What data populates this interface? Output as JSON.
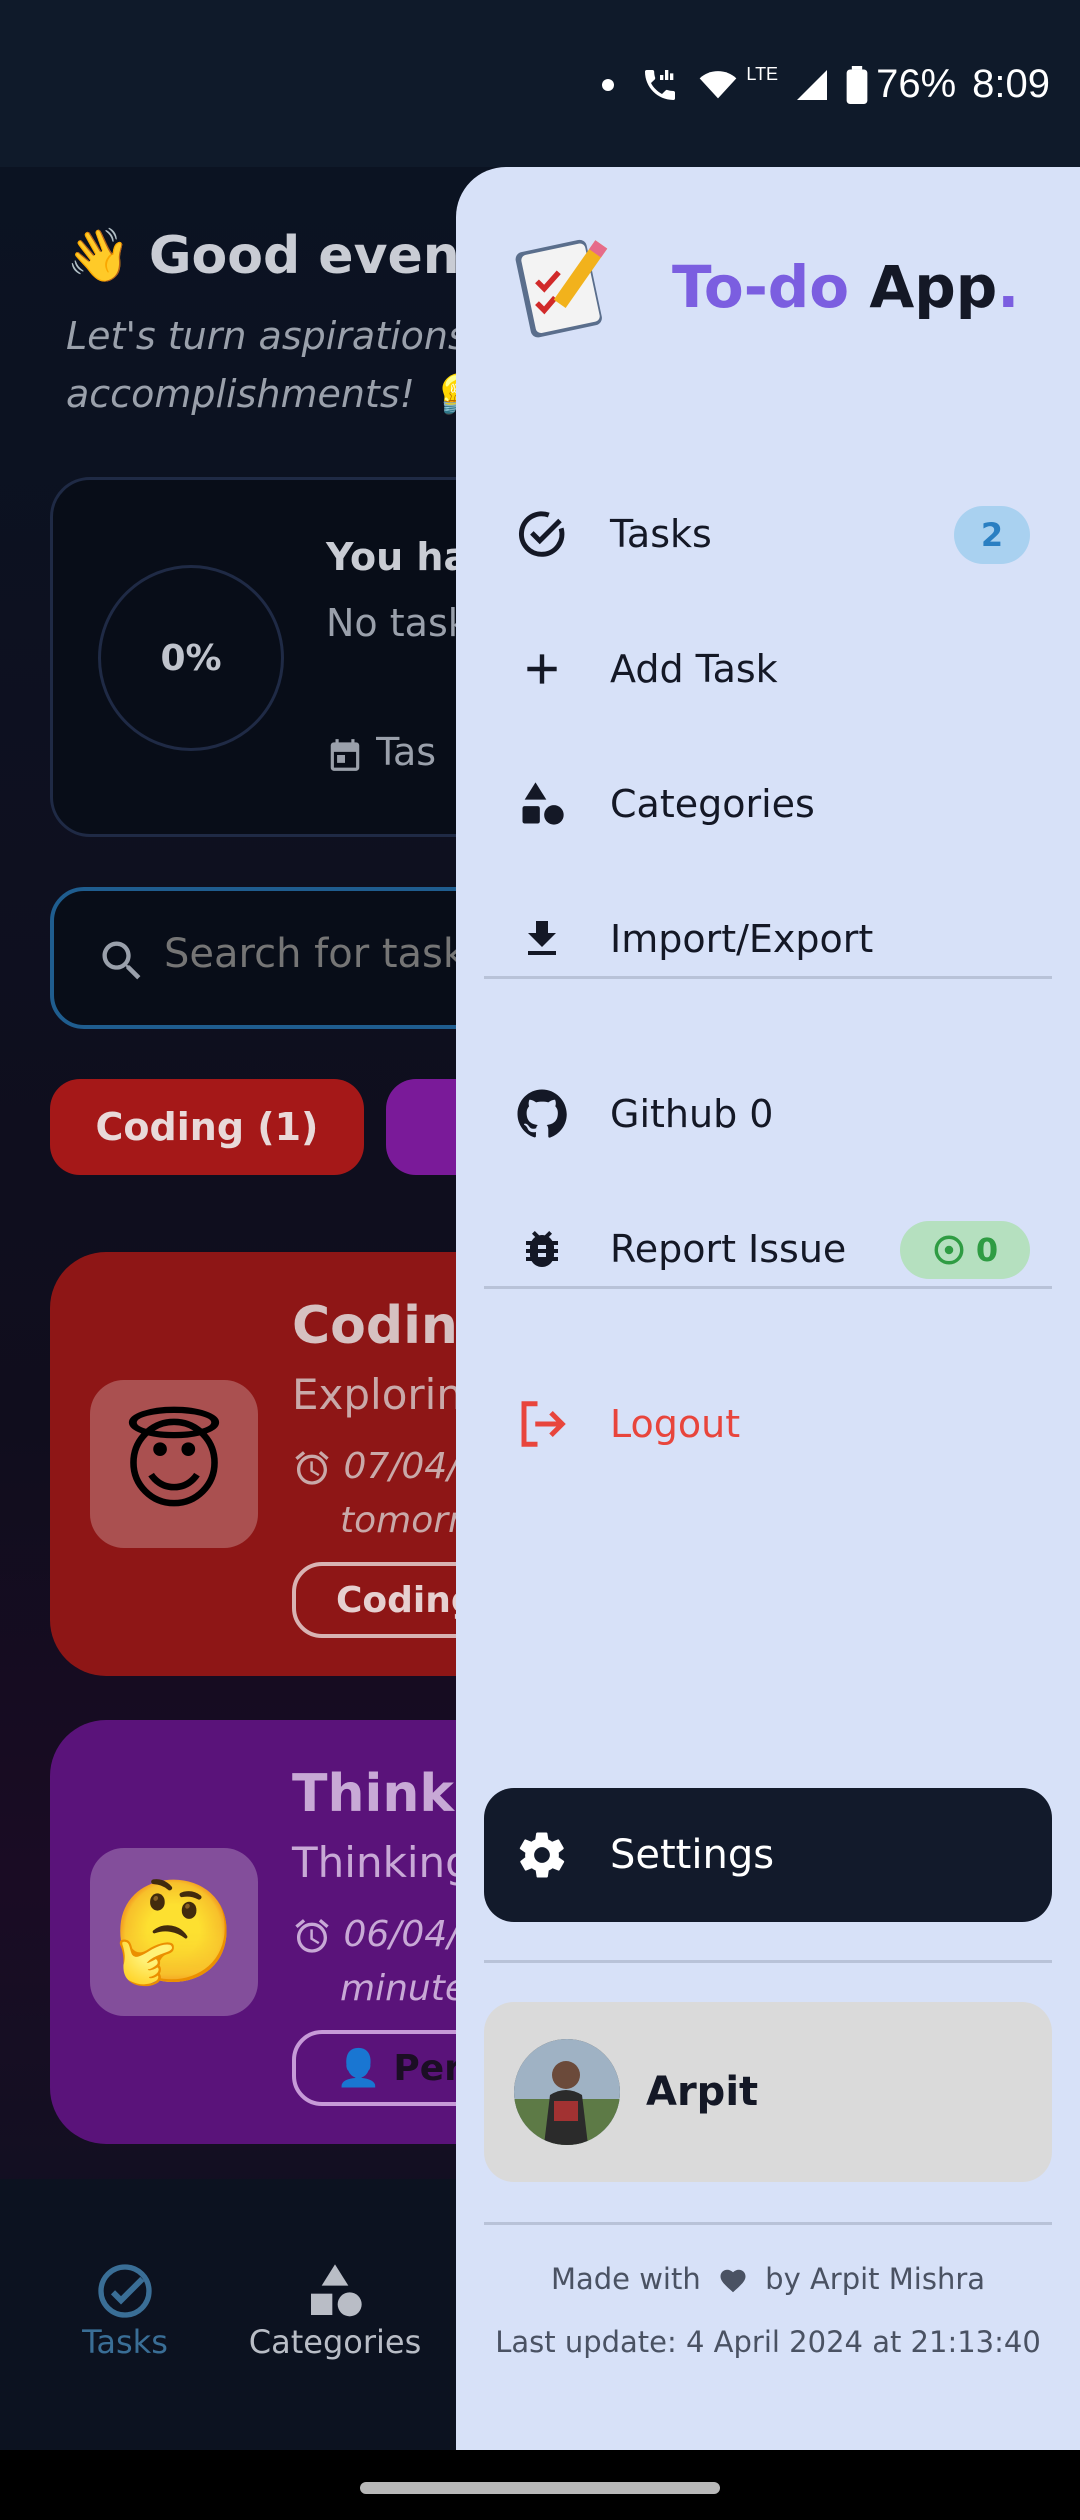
{
  "status_bar": {
    "battery": "76%",
    "time": "8:09",
    "network": "LTE"
  },
  "background_app": {
    "greeting": "👋 Good eveni",
    "subtitle_line1": "Let's turn aspirations",
    "subtitle_line2": "accomplishments! 💡",
    "progress": {
      "percent": "0%",
      "title": "You ha",
      "text": "No task going!",
      "date_label": "Tas"
    },
    "search_placeholder": "Search for task",
    "chips": [
      "Coding (1)",
      "👤"
    ],
    "tasks": [
      {
        "emoji": "😇",
        "title": "Coding",
        "desc": "Explorin",
        "date": "07/04/",
        "date2": "tomorr",
        "chip": "Coding"
      },
      {
        "emoji": "🤔",
        "title": "Thinkir",
        "desc": "Thinking",
        "date": "06/04/",
        "date2": "minute",
        "chip": "👤 Pers"
      }
    ],
    "bottom_nav": {
      "tasks": "Tasks",
      "categories": "Categories"
    }
  },
  "drawer": {
    "title_part1": "To-do",
    "title_part2": " App",
    "title_part3": ".",
    "menu": {
      "tasks": {
        "label": "Tasks",
        "badge": "2"
      },
      "add_task": {
        "label": "Add Task"
      },
      "categories": {
        "label": "Categories"
      },
      "import_export": {
        "label": "Import/Export"
      },
      "github": {
        "label": "Github 0"
      },
      "report_issue": {
        "label": "Report Issue",
        "badge": "0"
      },
      "logout": {
        "label": "Logout"
      }
    },
    "settings_label": "Settings",
    "user_name": "Arpit",
    "footer_made_with": "Made with",
    "footer_by": "by Arpit Mishra",
    "footer_last_update": "Last update: 4 April 2024 at 21:13:40"
  },
  "colors": {
    "accent": "#7b5ee0",
    "logout": "#e8453c",
    "drawer_bg": "#d7e1f8"
  }
}
